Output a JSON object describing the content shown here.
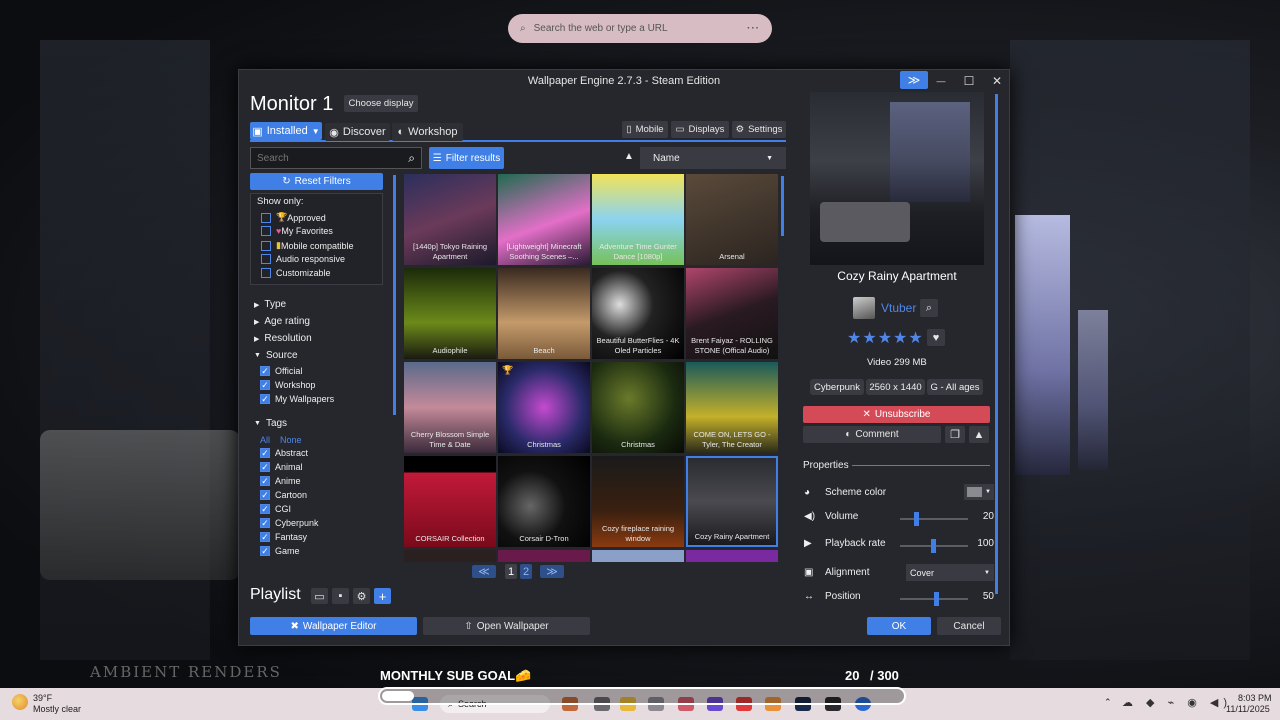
{
  "browser": {
    "placeholder": "Search the web or type a URL",
    "menu": "···"
  },
  "window": {
    "title": "Wallpaper Engine 2.7.3 - Steam Edition",
    "expand": "≫",
    "minimize": "—",
    "maximize": "☐",
    "close": "✕"
  },
  "header": {
    "monitor": "Monitor 1",
    "choose": "Choose display"
  },
  "tabs": [
    {
      "label": "Installed",
      "icon": "monitor-icon"
    },
    {
      "label": "Discover",
      "icon": "compass-icon"
    },
    {
      "label": "Workshop",
      "icon": "steam-icon"
    }
  ],
  "toolbar": {
    "mobile": "Mobile",
    "displays": "Displays",
    "settings": "Settings"
  },
  "search": {
    "placeholder": "Search",
    "filter": "Filter results",
    "sort": "Name"
  },
  "filters": {
    "reset": "Reset Filters",
    "show_only_title": "Show only:",
    "show_only": [
      {
        "label": "Approved",
        "checked": false
      },
      {
        "label": "My Favorites",
        "checked": false
      },
      {
        "label": "Mobile compatible",
        "checked": false
      },
      {
        "label": "Audio responsive",
        "checked": false
      },
      {
        "label": "Customizable",
        "checked": false
      }
    ],
    "collapsed": [
      "Type",
      "Age rating",
      "Resolution"
    ],
    "source_title": "Source",
    "source": [
      {
        "label": "Official",
        "checked": true
      },
      {
        "label": "Workshop",
        "checked": true
      },
      {
        "label": "My Wallpapers",
        "checked": true
      }
    ],
    "tags_title": "Tags",
    "all": "All",
    "none": "None",
    "tags": [
      {
        "label": "Abstract",
        "checked": true
      },
      {
        "label": "Animal",
        "checked": true
      },
      {
        "label": "Anime",
        "checked": true
      },
      {
        "label": "Cartoon",
        "checked": true
      },
      {
        "label": "CGI",
        "checked": true
      },
      {
        "label": "Cyberpunk",
        "checked": true
      },
      {
        "label": "Fantasy",
        "checked": true
      },
      {
        "label": "Game",
        "checked": true
      }
    ]
  },
  "grid": [
    {
      "title": "[1440p] Tokyo Raining Apartment",
      "bg": "linear-gradient(160deg,#2b2f5c,#6b3a5a 50%,#1b1a2a)"
    },
    {
      "title": "[Lightweight] Minecraft Soothing Scenes –...",
      "bg": "linear-gradient(160deg,#1f6b4f,#e36fc8 55%,#2a1a33)"
    },
    {
      "title": "Adventure Time Gunter Dance [1080p]",
      "bg": "linear-gradient(180deg,#f0e35a,#8bd3f0 50%,#76c15a)"
    },
    {
      "title": "Arsenal",
      "bg": "linear-gradient(160deg,#5a4a3a,#2b2420)"
    },
    {
      "title": "Audiophile",
      "bg": "linear-gradient(180deg,#1b2a0a,#6c8a1a 60%,#1a1a10)"
    },
    {
      "title": "Beach",
      "bg": "linear-gradient(180deg,#3a2a20,#c49a6a 60%,#7a5a3a)"
    },
    {
      "title": "Beautiful ButterFlies - 4K Oled Particles",
      "bg": "radial-gradient(circle at 30% 40%,#ddd,#222 40%,#000)"
    },
    {
      "title": "Brent Faiyaz - ROLLING STONE (Offical Audio)",
      "bg": "linear-gradient(160deg,#b0466a,#2a1a22 50%,#111)"
    },
    {
      "title": "Cherry Blossom Simple Time & Date",
      "bg": "linear-gradient(180deg,#5a6a8a,#c48a9a 50%,#3a2a3a)"
    },
    {
      "title": "Christmas",
      "bg": "radial-gradient(circle at 50% 50%,#c44ad0,#2a2a6a 60%,#0a0a20)"
    },
    {
      "title": "Christmas",
      "bg": "radial-gradient(circle at 40% 40%,#6a7a2a,#1a2a10 60%,#0a0a05)"
    },
    {
      "title": "COME ON, LETS GO - Tyler, The Creator",
      "bg": "linear-gradient(180deg,#1a5a5a,#c4b02a 60%,#2a2a1a)"
    },
    {
      "title": "CORSAIR Collection",
      "bg": "linear-gradient(180deg,#000 18%,#c21a3a 18%,#7a0a1a)"
    },
    {
      "title": "Corsair D-Tron",
      "bg": "radial-gradient(circle at 35% 55%,#666,#111 45%,#000)"
    },
    {
      "title": "Cozy fireplace raining window",
      "bg": "linear-gradient(180deg,#1a1a1a,#3a2010 60%,#8a3a10)"
    },
    {
      "title": "Cozy Rainy Apartment",
      "bg": "linear-gradient(180deg,#2a2c32,#4a4a50 50%,#1a1a1e)"
    }
  ],
  "pagination": {
    "prev": "≪",
    "page1": "1",
    "page2": "2",
    "next": "≫"
  },
  "playlist": {
    "title": "Playlist"
  },
  "bottom": {
    "editor": "Wallpaper Editor",
    "open": "Open Wallpaper",
    "ok": "OK",
    "cancel": "Cancel"
  },
  "details": {
    "title": "Cozy Rainy Apartment",
    "author": "Vtuber",
    "stars": "★★★★★",
    "type": "Video",
    "size": "299 MB",
    "tags": [
      "Cyberpunk",
      "2560 x 1440",
      "G - All ages"
    ],
    "unsubscribe": "Unsubscribe",
    "comment": "Comment",
    "properties": "Properties",
    "props": [
      {
        "label": "Scheme color",
        "icon": "palette-icon"
      },
      {
        "label": "Volume",
        "icon": "volume-icon",
        "value": "20",
        "level": 0.2
      },
      {
        "label": "Playback rate",
        "icon": "play-icon",
        "value": "100",
        "level": 0.45
      },
      {
        "label": "Alignment",
        "icon": "image-icon",
        "select": "Cover"
      },
      {
        "label": "Position",
        "icon": "move-icon",
        "value": "50",
        "level": 0.5
      }
    ]
  },
  "stream": {
    "goal": "MONTHLY SUB GOAL🧀",
    "current": "20",
    "total": "/ 300",
    "watermark": "AMBIENT RENDERS"
  },
  "taskbar": {
    "temp": "39°F",
    "weather": "Mostly clear",
    "search": "Search",
    "time": "8:03 PM",
    "date": "11/11/2025"
  },
  "colors": {
    "accent": "#3f7fe6",
    "danger": "#d54a57"
  }
}
